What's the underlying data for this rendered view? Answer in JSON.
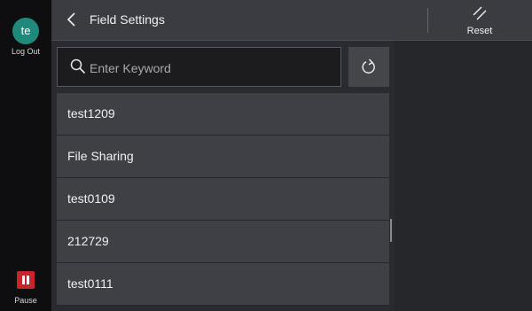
{
  "sidebar": {
    "user_initials": "te",
    "logout_label": "Log Out",
    "pause_label": "Pause"
  },
  "header": {
    "title": "Field Settings",
    "reset_label": "Reset"
  },
  "search": {
    "placeholder": "Enter Keyword",
    "value": ""
  },
  "items": [
    {
      "label": "test1209"
    },
    {
      "label": "File Sharing"
    },
    {
      "label": "test0109"
    },
    {
      "label": "212729"
    },
    {
      "label": "test0111"
    }
  ],
  "icons": {
    "back": "chevron-left-icon",
    "reset": "reset-icon",
    "search": "search-icon",
    "refresh": "refresh-icon",
    "pause": "pause-icon"
  },
  "colors": {
    "avatar": "#1f8a7c",
    "pause": "#c8242c"
  }
}
